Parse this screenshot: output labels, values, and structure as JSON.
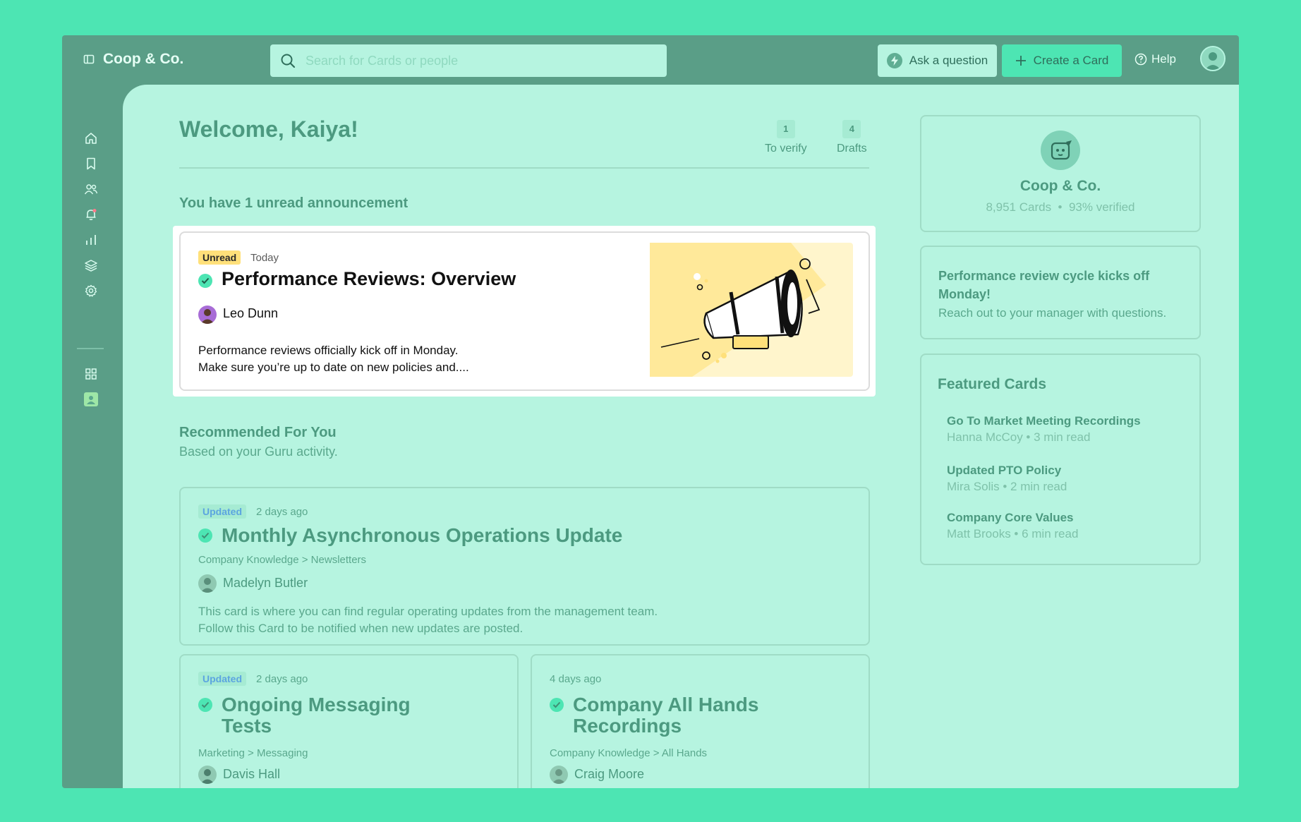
{
  "app": {
    "brand": "Coop & Co."
  },
  "search": {
    "placeholder": "Search for Cards or people"
  },
  "header": {
    "ask_label": "Ask a question",
    "create_label": "Create a Card",
    "help_label": "Help"
  },
  "rail": {
    "icons": [
      "home-icon",
      "bookmark-icon",
      "people-icon",
      "bell-icon",
      "analytics-icon",
      "collections-icon",
      "settings-icon",
      "apps-grid-icon",
      "user-app-icon"
    ]
  },
  "welcome": {
    "title": "Welcome, Kaiya!",
    "stats": [
      {
        "count": "1",
        "label": "To verify"
      },
      {
        "count": "4",
        "label": "Drafts"
      }
    ]
  },
  "announcement": {
    "heading": "You have 1 unread announcement",
    "badge": "Unread",
    "date": "Today",
    "title": "Performance Reviews: Overview",
    "author": "Leo Dunn",
    "body_line1": "Performance reviews officially kick off in Monday.",
    "body_line2": "Make sure you’re up to date on new policies and...."
  },
  "recommended": {
    "heading": "Recommended For You",
    "subheading": "Based on your Guru activity.",
    "cards": [
      {
        "badge": "Updated",
        "date": "2 days ago",
        "title": "Monthly Asynchronous Operations Update",
        "path": "Company Knowledge > Newsletters",
        "author": "Madelyn Butler",
        "body_line1": "This card is where you can find regular operating updates from the management team.",
        "body_line2": "Follow this Card to be notified when new updates are posted."
      },
      {
        "badge": "Updated",
        "date": "2 days ago",
        "title_line1": "Ongoing Messaging",
        "title_line2": "Tests",
        "path": "Marketing > Messaging",
        "author": "Davis Hall"
      },
      {
        "date": "4 days ago",
        "title_line1": "Company All Hands",
        "title_line2": "Recordings",
        "path": "Company Knowledge > All Hands",
        "author": "Craig Moore"
      }
    ]
  },
  "org": {
    "name": "Coop & Co.",
    "cards": "8,951 Cards",
    "separator": "•",
    "verified": "93% verified"
  },
  "notice": {
    "title": "Performance review cycle kicks off Monday!",
    "body": "Reach out to your manager with questions."
  },
  "featured": {
    "title": "Featured Cards",
    "items": [
      {
        "name": "Go To Market Meeting Recordings",
        "meta": "Hanna McCoy • 3 min read"
      },
      {
        "name": "Updated PTO Policy",
        "meta": "Mira Solis • 2 min read"
      },
      {
        "name": "Company Core Values",
        "meta": "Matt Brooks • 6 min read"
      }
    ]
  },
  "colors": {
    "page_bg": "#4de5b3",
    "frame": "#5a9e87",
    "panel": "#b6f4e0",
    "accent_text": "#4c9a80",
    "unread_badge": "#ffe07a",
    "updated_badge_text": "#5ca5e0"
  }
}
